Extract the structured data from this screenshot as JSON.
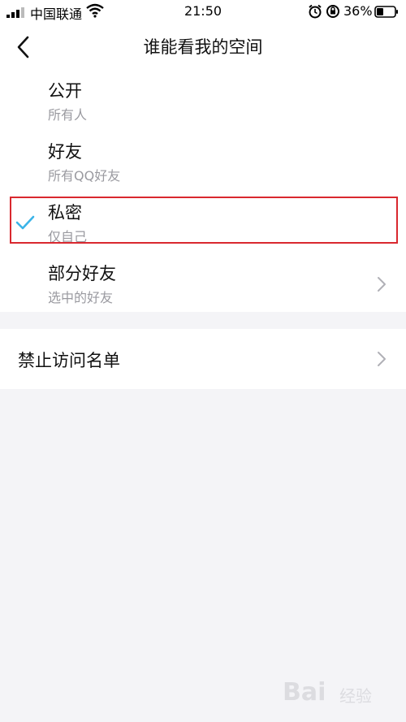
{
  "status_bar": {
    "carrier": "中国联通",
    "time": "21:50",
    "battery_percent": "36%"
  },
  "nav": {
    "title": "谁能看我的空间"
  },
  "options": [
    {
      "title": "公开",
      "subtitle": "所有人",
      "selected": false,
      "has_chevron": false
    },
    {
      "title": "好友",
      "subtitle": "所有QQ好友",
      "selected": false,
      "has_chevron": false
    },
    {
      "title": "私密",
      "subtitle": "仅自己",
      "selected": true,
      "has_chevron": false
    },
    {
      "title": "部分好友",
      "subtitle": "选中的好友",
      "selected": false,
      "has_chevron": true
    }
  ],
  "deny_list": {
    "label": "禁止访问名单"
  },
  "watermark": {
    "logo_text": "Bai",
    "text": "经验"
  },
  "colors": {
    "check": "#3bb4e8",
    "highlight_border": "#d9282f",
    "background": "#f4f4f7"
  }
}
